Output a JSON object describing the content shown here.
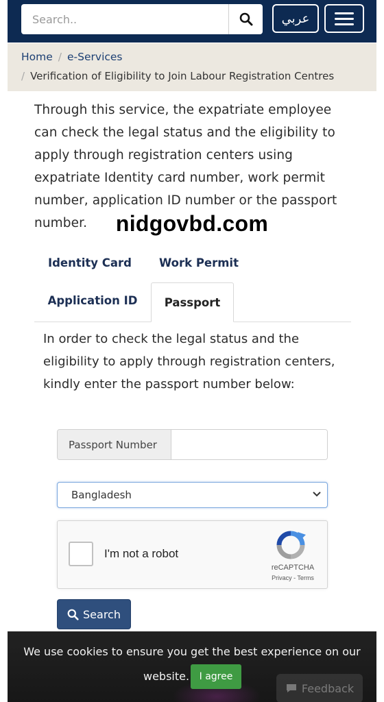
{
  "header": {
    "search_placeholder": "Search..",
    "language_label": "عربي",
    "search_icon": "search-icon",
    "menu_icon": "hamburger-menu-icon"
  },
  "breadcrumb": {
    "home": "Home",
    "separator": "/",
    "eservices": "e-Services",
    "current": "Verification of Eligibility to Join Labour Registration Centres"
  },
  "intro": {
    "text": "Through this service, the expatriate employee can check the legal status and the eligibility to apply through registration centers using expatriate Identity card number, work permit number, application ID number or the passport number."
  },
  "watermark": "nidgovbd.com",
  "tabs": [
    {
      "label": "Identity Card",
      "active": false
    },
    {
      "label": "Work Permit",
      "active": false
    },
    {
      "label": "Application ID",
      "active": false
    },
    {
      "label": "Passport",
      "active": true
    }
  ],
  "passport_form": {
    "instructions": "In order to check the legal status and the eligibility to apply through registration centers, kindly enter the passport number below:",
    "passport_label": "Passport Number",
    "passport_value": "",
    "country_selected": "Bangladesh",
    "captcha_label": "I'm not a robot",
    "captcha_brand": "reCAPTCHA",
    "captcha_links": "Privacy - Terms",
    "submit_label": "Search"
  },
  "cookie_bar": {
    "text_line1": "We use cookies to ensure you get the best experience on our",
    "text_line2": "website.",
    "agree_label": "I agree",
    "feedback_label": "Feedback"
  },
  "colors": {
    "header_bg": "#0d2a52",
    "breadcrumb_bg": "#ece8e0",
    "submit_bg": "#2f4f7d",
    "agree_bg": "#3f9b43",
    "cookie_bg": "#1c1c1c"
  }
}
